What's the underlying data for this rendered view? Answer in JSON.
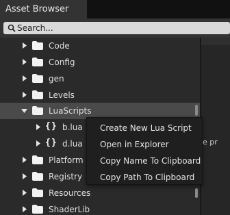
{
  "window": {
    "tab_title": "Asset Browser"
  },
  "search": {
    "placeholder": "Search..."
  },
  "tree": {
    "items": [
      {
        "label": "Code",
        "type": "folder",
        "expanded": false
      },
      {
        "label": "Config",
        "type": "folder",
        "expanded": false
      },
      {
        "label": "gen",
        "type": "folder",
        "expanded": false
      },
      {
        "label": "Levels",
        "type": "folder",
        "expanded": false
      },
      {
        "label": "LuaScripts",
        "type": "folder",
        "expanded": true,
        "selected": true
      },
      {
        "label": "b.lua",
        "type": "script",
        "icon": "{}"
      },
      {
        "label": "d.lua",
        "type": "script",
        "icon": "{}"
      },
      {
        "label": "Platform",
        "type": "folder",
        "expanded": false
      },
      {
        "label": "Registry",
        "type": "folder",
        "expanded": false
      },
      {
        "label": "Resources",
        "type": "folder",
        "expanded": false
      },
      {
        "label": "ShaderLib",
        "type": "folder",
        "expanded": false
      }
    ]
  },
  "right_panel": {
    "peek_text": "e pr"
  },
  "context_menu": {
    "items": [
      "Create New Lua Script",
      "Open in Explorer",
      "Copy Name To Clipboard",
      "Copy Path To Clipboard"
    ]
  },
  "colors": {
    "background": "#222222",
    "tree_background": "#2a2a2a",
    "selected_row": "#4a4a4a",
    "menu_background": "#1f1f1f",
    "text": "#e0e0e0"
  }
}
